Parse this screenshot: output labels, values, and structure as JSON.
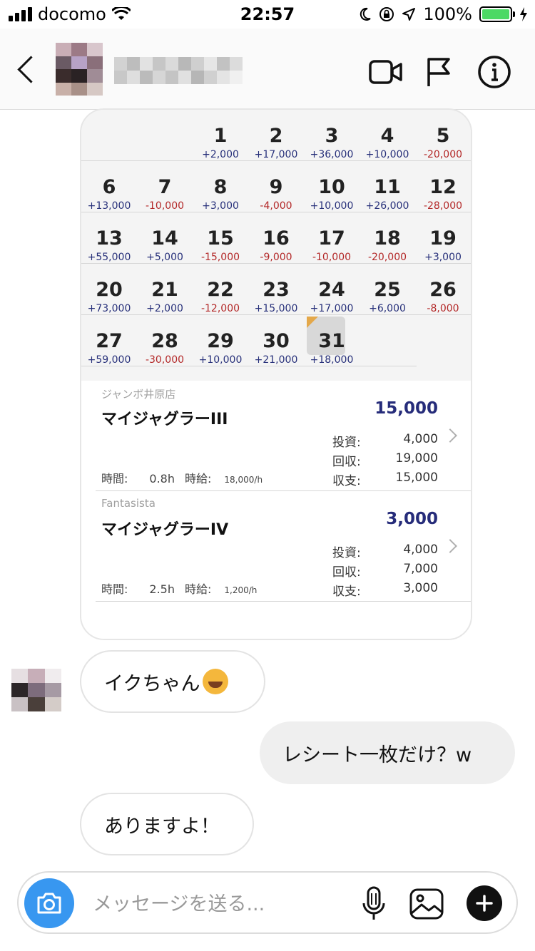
{
  "status_bar": {
    "carrier": "docomo",
    "time": "22:57",
    "battery": "100%",
    "icons": [
      "signal-icon",
      "wifi-icon",
      "moon-icon",
      "orientation-lock-icon",
      "location-icon",
      "battery-icon",
      "charging-icon"
    ]
  },
  "header": {
    "icons": [
      "back-icon",
      "video-call-icon",
      "flag-icon",
      "info-icon"
    ]
  },
  "calendar": {
    "weeks": [
      [
        null,
        null,
        {
          "day": "1",
          "amount": "+2,000"
        },
        {
          "day": "2",
          "amount": "+17,000"
        },
        {
          "day": "3",
          "amount": "+36,000"
        },
        {
          "day": "4",
          "amount": "+10,000"
        },
        {
          "day": "5",
          "amount": "-20,000"
        }
      ],
      [
        {
          "day": "6",
          "amount": "+13,000"
        },
        {
          "day": "7",
          "amount": "-10,000"
        },
        {
          "day": "8",
          "amount": "+3,000"
        },
        {
          "day": "9",
          "amount": "-4,000"
        },
        {
          "day": "10",
          "amount": "+10,000"
        },
        {
          "day": "11",
          "amount": "+26,000"
        },
        {
          "day": "12",
          "amount": "-28,000"
        }
      ],
      [
        {
          "day": "13",
          "amount": "+55,000"
        },
        {
          "day": "14",
          "amount": "+5,000"
        },
        {
          "day": "15",
          "amount": "-15,000"
        },
        {
          "day": "16",
          "amount": "-9,000"
        },
        {
          "day": "17",
          "amount": "-10,000"
        },
        {
          "day": "18",
          "amount": "-20,000"
        },
        {
          "day": "19",
          "amount": "+3,000"
        }
      ],
      [
        {
          "day": "20",
          "amount": "+73,000"
        },
        {
          "day": "21",
          "amount": "+2,000"
        },
        {
          "day": "22",
          "amount": "-12,000"
        },
        {
          "day": "23",
          "amount": "+15,000"
        },
        {
          "day": "24",
          "amount": "+17,000"
        },
        {
          "day": "25",
          "amount": "+6,000"
        },
        {
          "day": "26",
          "amount": "-8,000"
        }
      ],
      [
        {
          "day": "27",
          "amount": "+59,000"
        },
        {
          "day": "28",
          "amount": "-30,000"
        },
        {
          "day": "29",
          "amount": "+10,000"
        },
        {
          "day": "30",
          "amount": "+21,000"
        },
        {
          "day": "31",
          "amount": "+18,000",
          "selected": true
        },
        null,
        null
      ]
    ],
    "colors": {
      "positive": "#27307a",
      "negative": "#b32828",
      "today_flag": "#e4a84a"
    }
  },
  "entries": [
    {
      "store": "ジャンボ井原店",
      "machine": "マイジャグラーIII",
      "total": "15,000",
      "stats": [
        {
          "label": "投資:",
          "value": "4,000"
        },
        {
          "label": "回収:",
          "value": "19,000"
        },
        {
          "label": "収支:",
          "value": "15,000"
        }
      ],
      "time_label": "時間:",
      "time_value": "0.8h",
      "rate_label": "時給:",
      "rate_value": "18,000/h"
    },
    {
      "store": "Fantasista",
      "machine": "マイジャグラーIV",
      "total": "3,000",
      "stats": [
        {
          "label": "投資:",
          "value": "4,000"
        },
        {
          "label": "回収:",
          "value": "7,000"
        },
        {
          "label": "収支:",
          "value": "3,000"
        }
      ],
      "time_label": "時間:",
      "time_value": "2.5h",
      "rate_label": "時給:",
      "rate_value": "1,200/h"
    }
  ],
  "messages": [
    {
      "direction": "incoming",
      "text": "イクちゃん",
      "emoji": "rolling-on-floor-laughing-emoji"
    },
    {
      "direction": "outgoing",
      "text": "レシート一枚だけ？w"
    },
    {
      "direction": "incoming",
      "text": "ありますよ！"
    }
  ],
  "composer": {
    "placeholder": "メッセージを送る...",
    "icons": [
      "camera-icon",
      "microphone-icon",
      "gallery-icon",
      "plus-icon"
    ],
    "accent": "#3897f0"
  }
}
